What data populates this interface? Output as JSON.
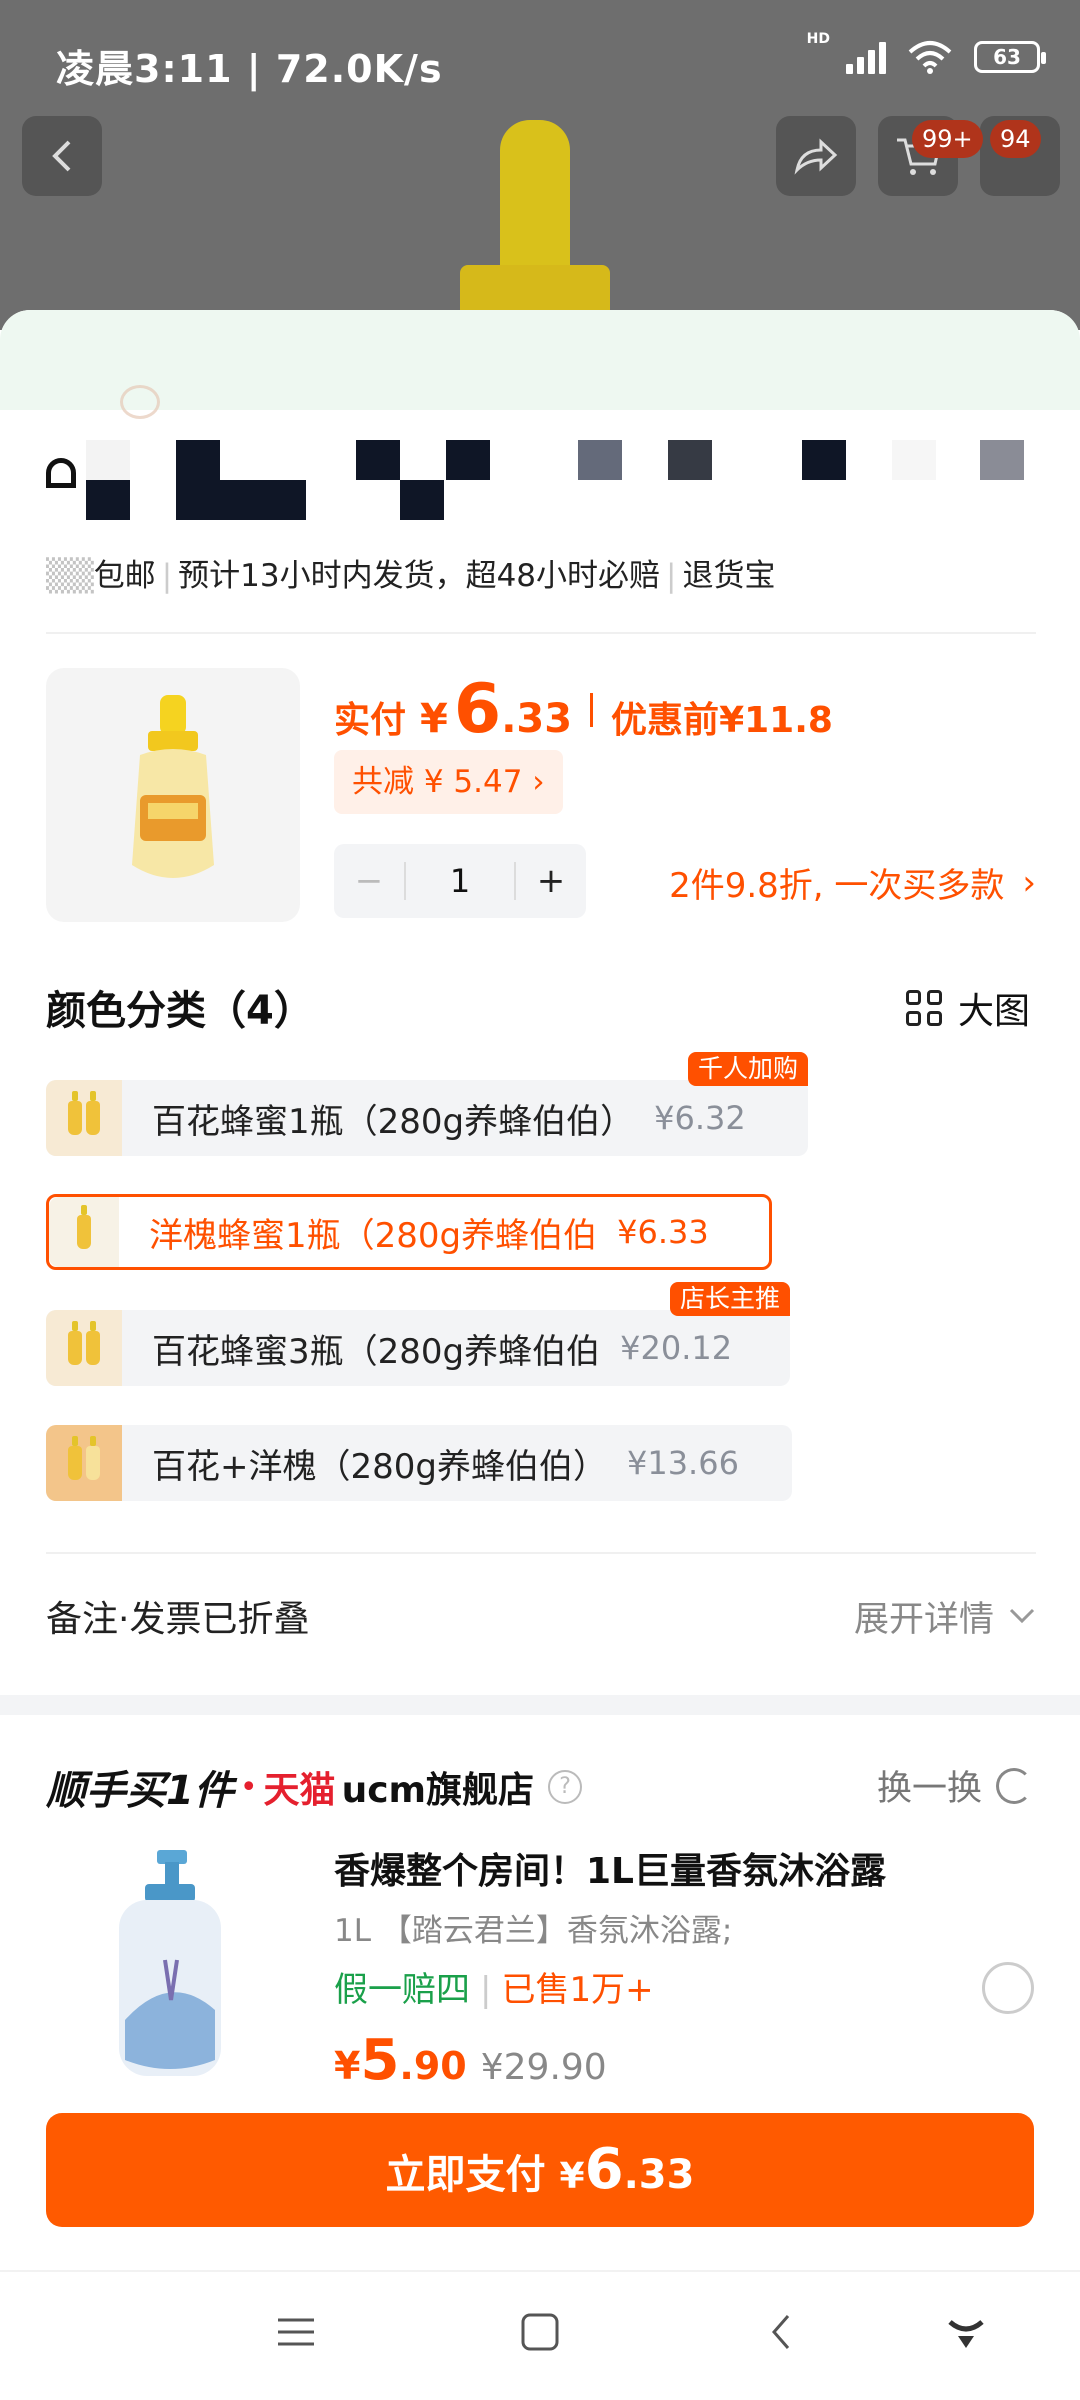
{
  "status_bar": {
    "time": "凌晨3:11 | 72.0K/s",
    "network_label": "HD",
    "battery": "63"
  },
  "top_bar": {
    "cart_badge": "99+",
    "message_badge": "94"
  },
  "shipping": {
    "free_shipping": "包邮",
    "eta": "预计13小时内发货，超48小时必赔",
    "return_service": "退货宝"
  },
  "product": {
    "paid_label": "实付",
    "currency": "¥",
    "price_int": "6",
    "price_dec": ".33",
    "before_label": "优惠前",
    "before_price": "¥11.8",
    "discount_text": "共减 ¥ 5.47 ›",
    "quantity": "1",
    "minus": "−",
    "plus": "+",
    "promo": "2件9.8折, 一次买多款",
    "promo_arrow": "›"
  },
  "colors": {
    "title": "颜色分类（4）",
    "big_view": "大图",
    "options": [
      {
        "name": "百花蜂蜜1瓶（280g养蜂伯伯）",
        "price": "¥6.32",
        "badge": "千人加购"
      },
      {
        "name": "洋槐蜂蜜1瓶（280g养蜂伯伯",
        "price": "¥6.33",
        "badge": ""
      },
      {
        "name": "百花蜂蜜3瓶（280g养蜂伯伯",
        "price": "¥20.12",
        "badge": "店长主推"
      },
      {
        "name": "百花+洋槐（280g养蜂伯伯）",
        "price": "¥13.66",
        "badge": ""
      }
    ]
  },
  "remark": {
    "label": "备注·发票已折叠",
    "expand": "展开详情"
  },
  "buy_along": {
    "title": "顺手买1件",
    "dot": "•",
    "tmall": "天猫",
    "shop": "ucm旗舰店",
    "help": "?",
    "swap": "换一换",
    "item": {
      "title": "香爆整个房间！1L巨量香氛沐浴露",
      "desc": "1L 【踏云君兰】香氛沐浴露;",
      "tag1": "假一赔四",
      "tag2": "已售1万+",
      "currency": "¥",
      "price_int": "5",
      "price_dec": ".90",
      "old_price": "¥29.90"
    }
  },
  "pay": {
    "label": "立即支付",
    "currency": "¥",
    "int": "6",
    "dec": ".33"
  },
  "colors_accent": {
    "brand_orange": "#ff5000",
    "green": "#1aa04a",
    "tmall_red": "#e5202e"
  },
  "icons": [
    "back-icon",
    "share-icon",
    "cart-icon",
    "message-icon",
    "grid-icon",
    "chevron-down-icon",
    "refresh-icon",
    "menu-icon",
    "home-icon",
    "nav-back-icon",
    "assistant-icon"
  ]
}
